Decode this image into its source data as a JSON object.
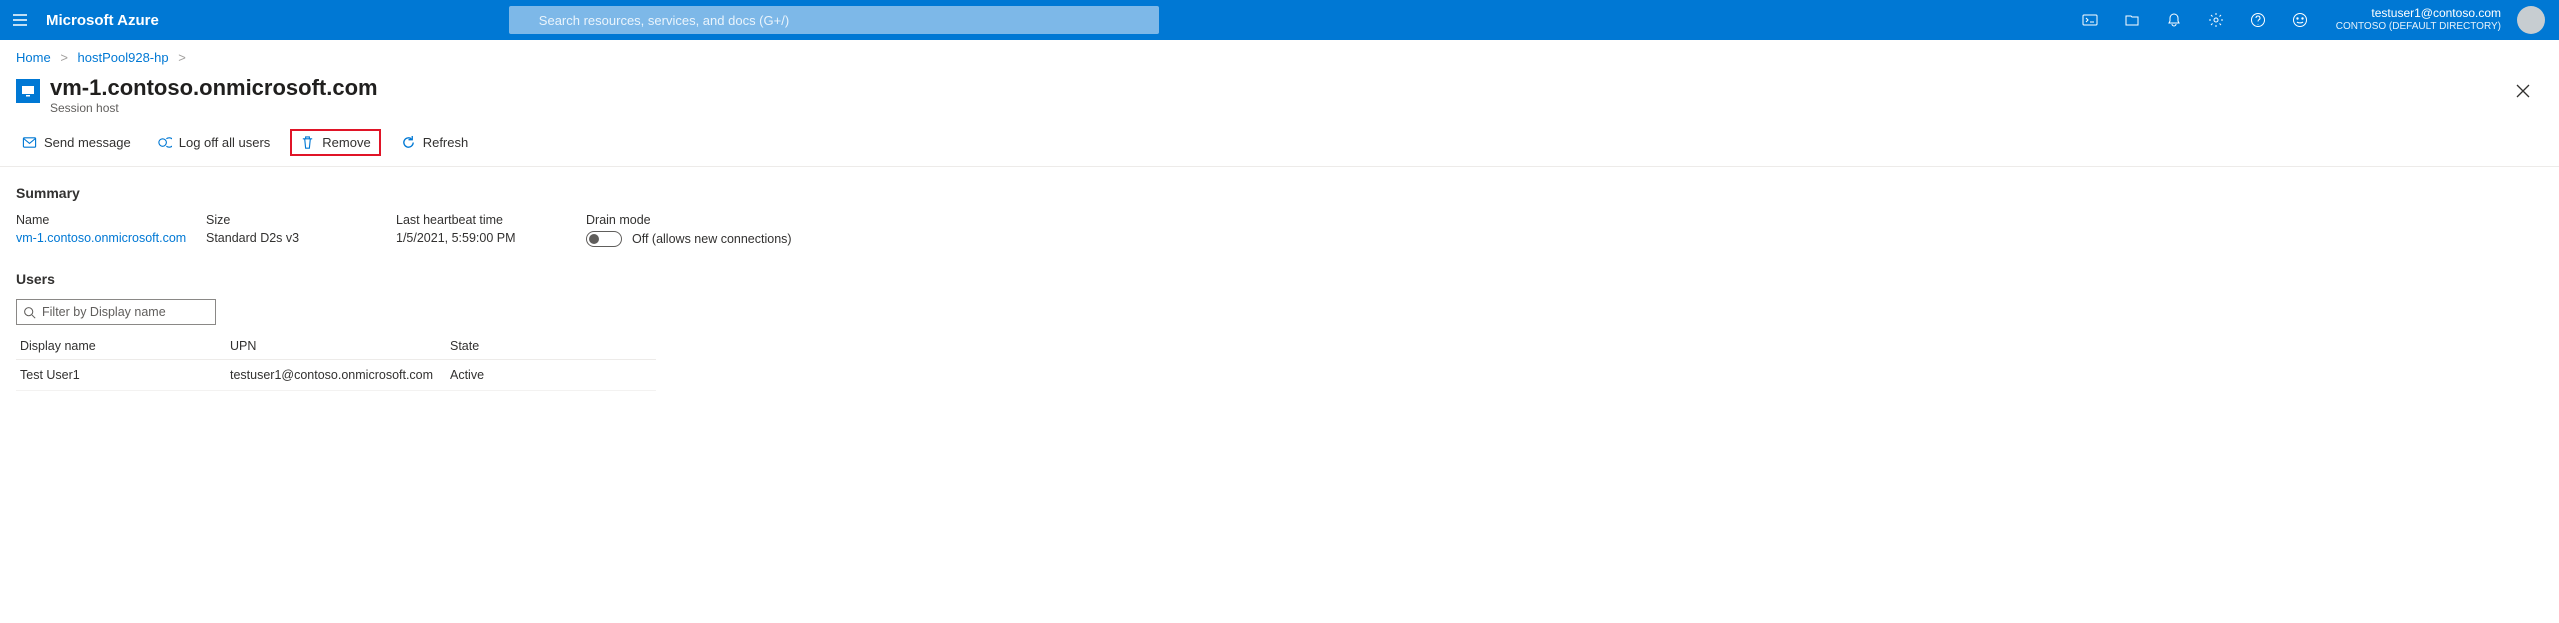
{
  "topbar": {
    "brand": "Microsoft Azure",
    "search_placeholder": "Search resources, services, and docs (G+/)",
    "account_email": "testuser1@contoso.com",
    "account_tenant": "CONTOSO (DEFAULT DIRECTORY)"
  },
  "breadcrumb": {
    "home": "Home",
    "hostpool": "hostPool928-hp"
  },
  "header": {
    "title": "vm-1.contoso.onmicrosoft.com",
    "subtitle": "Session host"
  },
  "toolbar": {
    "send_message": "Send message",
    "log_off": "Log off all users",
    "remove": "Remove",
    "refresh": "Refresh"
  },
  "summary": {
    "heading": "Summary",
    "name_label": "Name",
    "name_value": "vm-1.contoso.onmicrosoft.com",
    "size_label": "Size",
    "size_value": "Standard D2s v3",
    "heartbeat_label": "Last heartbeat time",
    "heartbeat_value": "1/5/2021, 5:59:00 PM",
    "drain_label": "Drain mode",
    "drain_state": "Off (allows new connections)"
  },
  "users": {
    "heading": "Users",
    "filter_placeholder": "Filter by Display name",
    "cols": {
      "name": "Display name",
      "upn": "UPN",
      "state": "State"
    },
    "rows": [
      {
        "name": "Test User1",
        "upn": "testuser1@contoso.onmicrosoft.com",
        "state": "Active"
      }
    ]
  }
}
